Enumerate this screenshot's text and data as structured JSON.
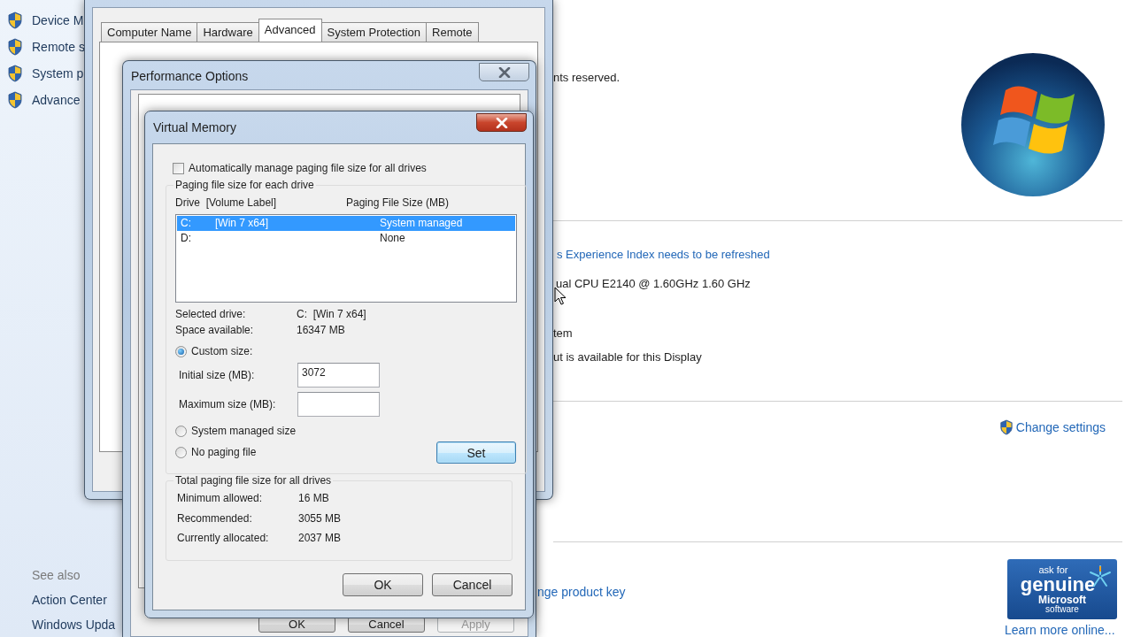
{
  "control_panel": {
    "sidebar_links": [
      "Device M",
      "Remote s",
      "System p",
      "Advance"
    ],
    "copyright_fragment": "nts reserved.",
    "experience_index_link": "s Experience Index needs to be refreshed",
    "processor_fragment": "ual CPU E2140 @ 1.60GHz 1.60 GHz",
    "system_type_fragment": "tem",
    "pen_touch_fragment": "ut is available for this Display",
    "change_settings_link": "Change settings",
    "product_key_link": "nge product key",
    "see_also": {
      "heading": "See also",
      "links": [
        "Action Center",
        "Windows Upda"
      ]
    },
    "genuine_badge": [
      "ask for",
      "genuine",
      "Microsoft",
      "software"
    ],
    "learn_more_link": "Learn more online..."
  },
  "system_properties": {
    "tabs": [
      {
        "label": "Computer Name",
        "selected": false
      },
      {
        "label": "Hardware",
        "selected": false
      },
      {
        "label": "Advanced",
        "selected": true
      },
      {
        "label": "System Protection",
        "selected": false
      },
      {
        "label": "Remote",
        "selected": false
      }
    ]
  },
  "performance_options": {
    "title": "Performance Options",
    "buttons": [
      {
        "label": "OK",
        "disabled": false
      },
      {
        "label": "Cancel",
        "disabled": false
      },
      {
        "label": "Apply",
        "disabled": true
      }
    ]
  },
  "virtual_memory": {
    "title": "Virtual Memory",
    "auto_manage": {
      "label": "Automatically manage paging file size for all drives",
      "checked": false
    },
    "drives_group": {
      "title": "Paging file size for each drive",
      "columns": [
        "Drive  [Volume Label]",
        "Paging File Size (MB)"
      ],
      "drives": [
        {
          "drive": "C:",
          "volume_label": "[Win 7 x64]",
          "paging_file_size": "System managed",
          "selected": true
        },
        {
          "drive": "D:",
          "paging_file_size": "None",
          "selected": false
        }
      ],
      "selected_drive": {
        "label": "Selected drive:",
        "value": "C:  [Win 7 x64]"
      },
      "space_available": {
        "label": "Space available:",
        "value": "16347 MB"
      },
      "size_options": [
        {
          "label": "Custom size:",
          "selected": true
        },
        {
          "label": "System managed size",
          "selected": false
        },
        {
          "label": "No paging file",
          "selected": false
        }
      ],
      "initial_size": {
        "label": "Initial size (MB):",
        "value": "3072"
      },
      "maximum_size": {
        "label": "Maximum size (MB):"
      },
      "set_button": {
        "label": "Set",
        "focused": true
      }
    },
    "totals_group": {
      "title": "Total paging file size for all drives",
      "rows": [
        {
          "label": "Minimum allowed:",
          "value": "16 MB"
        },
        {
          "label": "Recommended:",
          "value": "3055 MB"
        },
        {
          "label": "Currently allocated:",
          "value": "2037 MB"
        }
      ]
    },
    "buttons": [
      "OK",
      "Cancel"
    ]
  }
}
